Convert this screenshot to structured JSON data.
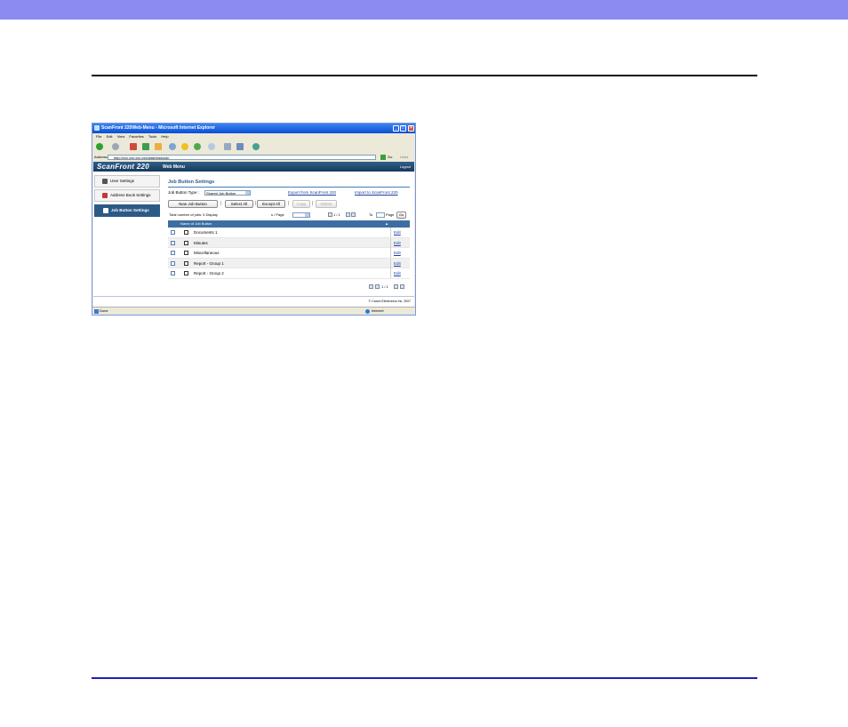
{
  "window": {
    "title": "ScanFront 220Web-Menu - Microsoft Internet Explorer",
    "menu": [
      "File",
      "Edit",
      "View",
      "Favorites",
      "Tools",
      "Help"
    ],
    "address_label": "Address",
    "address_url": "http://xxx.xxx.xxx.xxx/addressbook/",
    "go_label": "Go",
    "links_label": "Links",
    "status_left": "Done",
    "status_right": "Internet"
  },
  "app": {
    "logo": "ScanFront 220",
    "web_menu": "Web Menu",
    "logout": "Logout"
  },
  "sidebar": {
    "items": [
      {
        "label": "User Settings"
      },
      {
        "label": "Address Book Settings"
      },
      {
        "label": "Job Button Settings",
        "active": true
      }
    ]
  },
  "main": {
    "title": "Job Button Settings",
    "job_type_label": "Job Button Type :",
    "job_type_value": "Shared Job Button",
    "export_label": "Export from ScanFront 220",
    "import_label": "Import to ScanFront 220",
    "buttons": {
      "new": "New Job Button",
      "select_all": "Select All",
      "except_all": "Except All",
      "copy": "Copy",
      "delete": "Delete"
    },
    "total_label": "Total number of jobs: 5 Display",
    "per_page_label": "s / Page",
    "page_info": "1 / 1",
    "to_label": "To",
    "page_label": "Page",
    "go_button": "Go",
    "table": {
      "header": "Name of Job Button",
      "sort_icon": "▲",
      "rows": [
        {
          "name": "Documents 1",
          "edit": "Edit"
        },
        {
          "name": "Minutes",
          "edit": "Edit"
        },
        {
          "name": "Miscellaneous",
          "edit": "Edit"
        },
        {
          "name": "Report - Group 1",
          "edit": "Edit"
        },
        {
          "name": "Report - Group 2",
          "edit": "Edit"
        }
      ]
    },
    "footer_page": "1 / 1"
  },
  "copyright": "© Canon Electronics Inc. 2007"
}
